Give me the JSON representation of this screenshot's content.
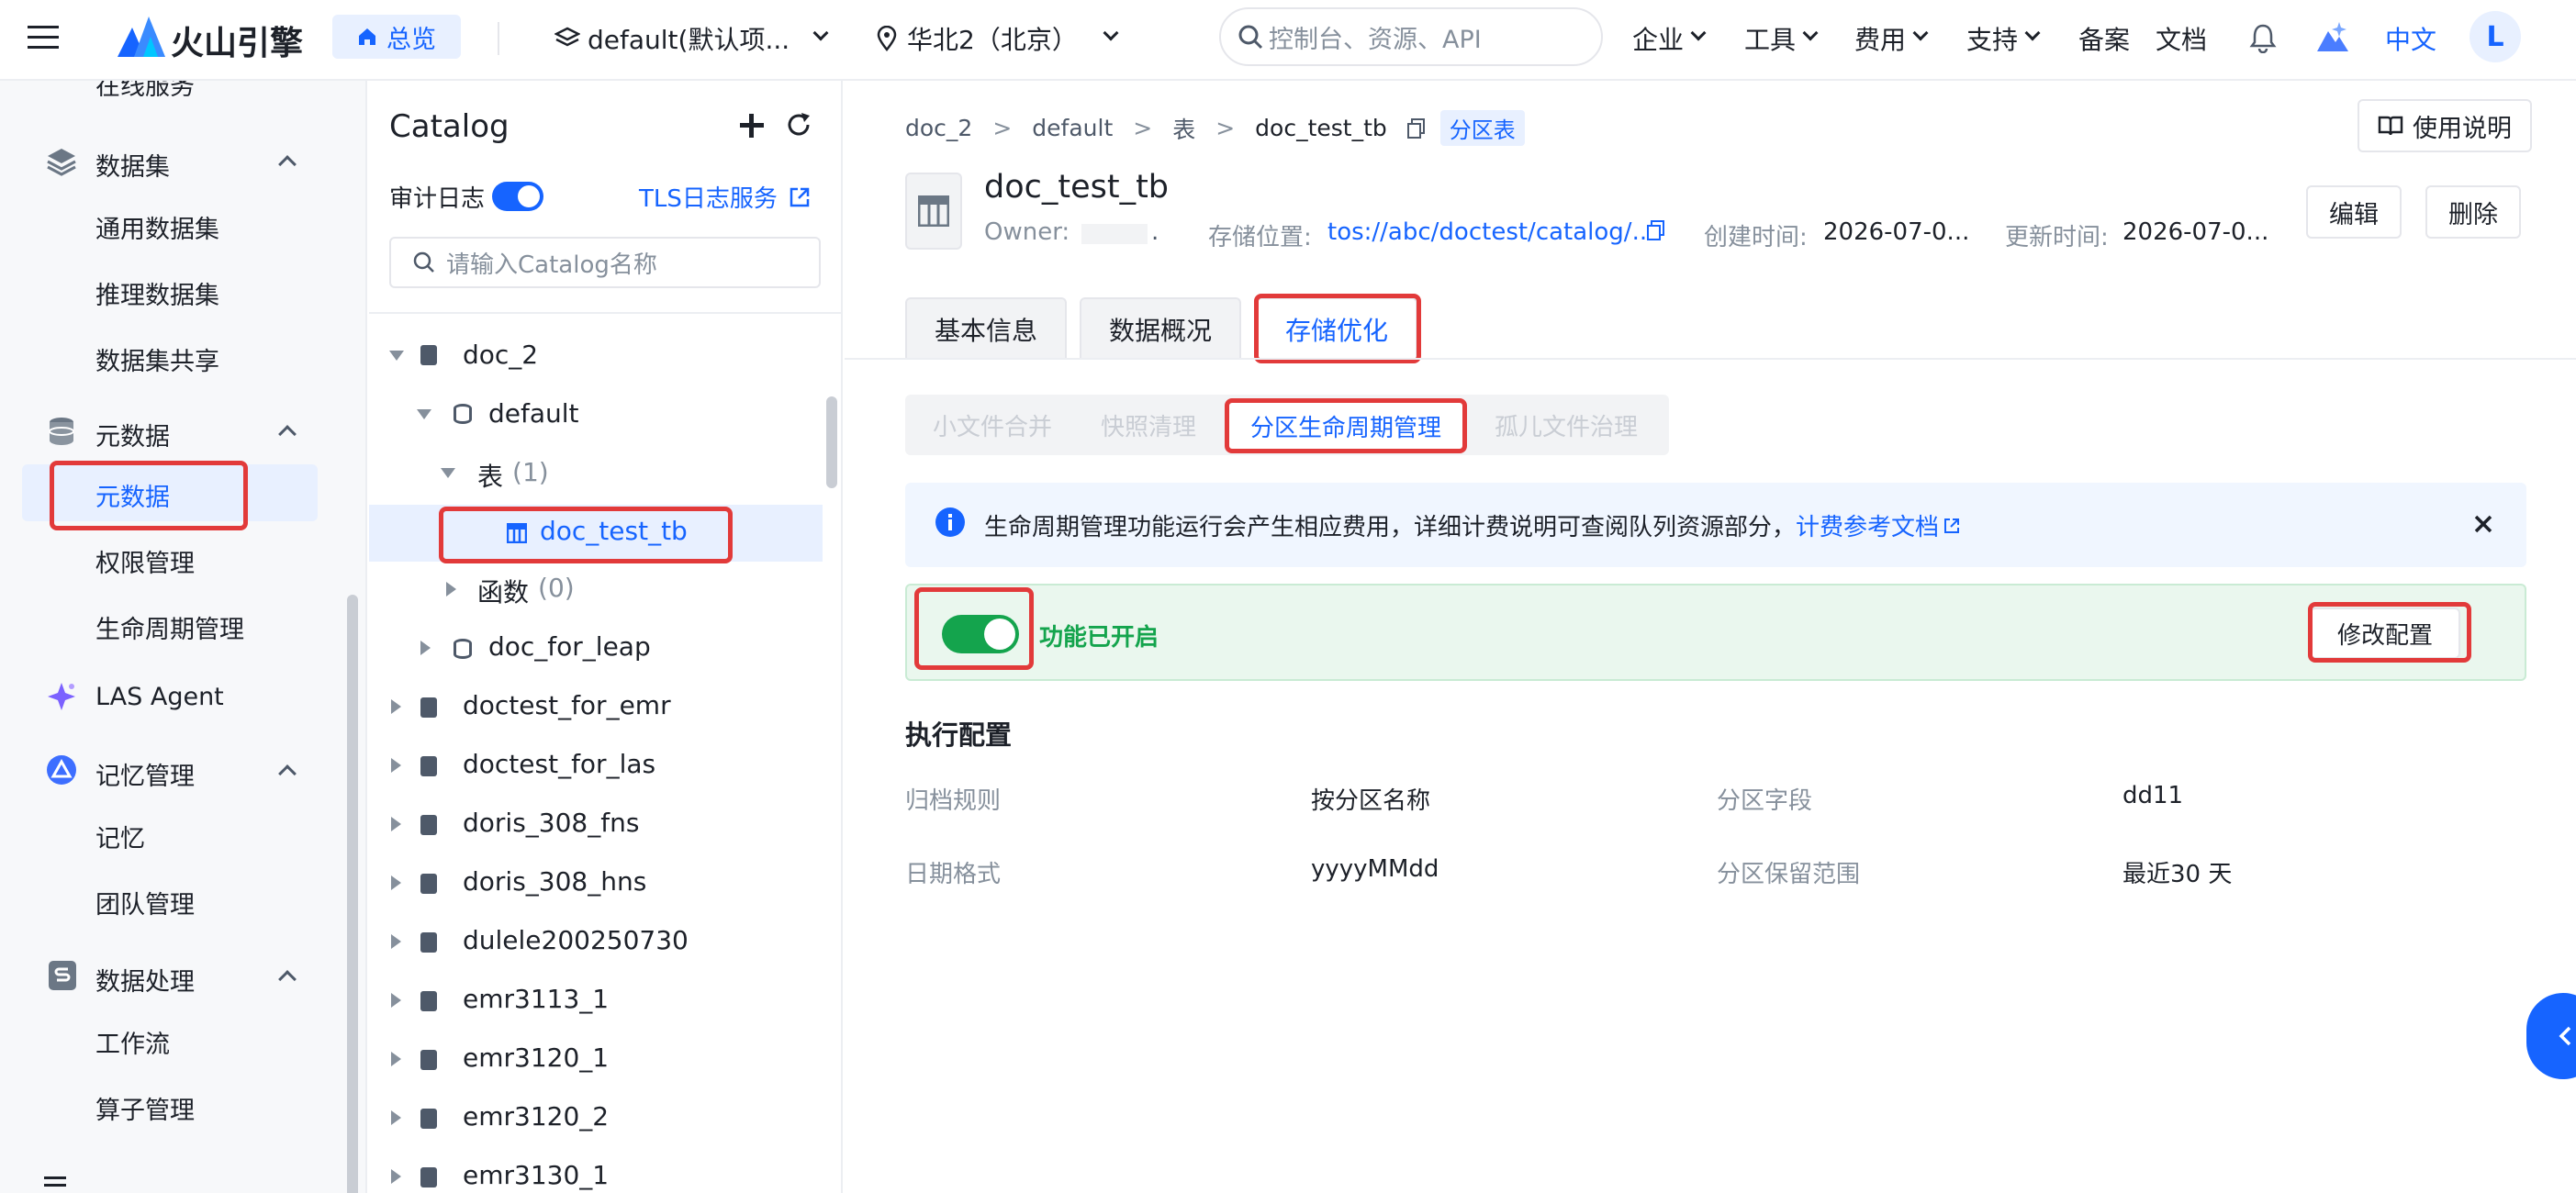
{
  "topbar": {
    "brand": "火山引擎",
    "home": "总览",
    "project": "default(默认项...",
    "region": "华北2（北京）",
    "search_placeholder": "控制台、资源、API",
    "menu": [
      "企业",
      "工具",
      "费用",
      "支持"
    ],
    "beian": "备案",
    "docs": "文档",
    "lang": "中文",
    "avatar": "L"
  },
  "sidebar": {
    "cutoff_item": "在线服务",
    "groups": [
      {
        "label": "数据集",
        "items": [
          "通用数据集",
          "推理数据集",
          "数据集共享"
        ]
      },
      {
        "label": "元数据",
        "items": [
          "元数据",
          "权限管理",
          "生命周期管理"
        ]
      },
      {
        "label": "LAS Agent",
        "items": []
      },
      {
        "label": "记忆管理",
        "items": [
          "记忆",
          "团队管理"
        ]
      },
      {
        "label": "数据处理",
        "items": [
          "工作流",
          "算子管理"
        ]
      }
    ]
  },
  "catalog": {
    "title": "Catalog",
    "audit_label": "审计日志",
    "audit_enabled": true,
    "tls_link": "TLS日志服务",
    "search_placeholder": "请输入Catalog名称",
    "tree": {
      "doc_2": "doc_2",
      "default": "default",
      "table_node": "表",
      "table_count": "(1)",
      "selected_table": "doc_test_tb",
      "func_node": "函数",
      "func_count": "(0)",
      "doc_for_leap": "doc_for_leap",
      "catalogs": [
        "doctest_for_emr",
        "doctest_for_las",
        "doris_308_fns",
        "doris_308_hns",
        "dulele200250730",
        "emr3113_1",
        "emr3120_1",
        "emr3120_2",
        "emr3130_1"
      ]
    }
  },
  "main": {
    "breadcrumb": [
      "doc_2",
      "default",
      "表",
      "doc_test_tb"
    ],
    "partition_badge": "分区表",
    "help_button": "使用说明",
    "table_name": "doc_test_tb",
    "owner_label": "Owner:",
    "owner_value": ".",
    "storage_label": "存储位置:",
    "storage_value": "tos://abc/doctest/catalog/...",
    "created_label": "创建时间:",
    "created_value": "2026-07-0...",
    "updated_label": "更新时间:",
    "updated_value": "2026-07-0...",
    "edit_button": "编辑",
    "delete_button": "删除",
    "tabs": [
      "基本信息",
      "数据概况",
      "存储优化"
    ],
    "active_tab": "存储优化",
    "sub_tabs": [
      "小文件合并",
      "快照清理",
      "分区生命周期管理",
      "孤儿文件治理"
    ],
    "active_sub_tab": "分区生命周期管理",
    "notice_text": "生命周期管理功能运行会产生相应费用，详细计费说明可查阅队列资源部分，",
    "notice_link": "计费参考文档",
    "feature_enabled": true,
    "feature_status": "功能已开启",
    "modify_button": "修改配置",
    "exec_title": "执行配置",
    "config": {
      "archive_rule_label": "归档规则",
      "archive_rule_value": "按分区名称",
      "partition_field_label": "分区字段",
      "partition_field_value": "dd11",
      "date_format_label": "日期格式",
      "date_format_value": "yyyyMMdd",
      "retention_label": "分区保留范围",
      "retention_value": "最近30 天"
    }
  },
  "colors": {
    "primary": "#1664ff",
    "success": "#14a44d",
    "highlight": "#e23a3a"
  }
}
